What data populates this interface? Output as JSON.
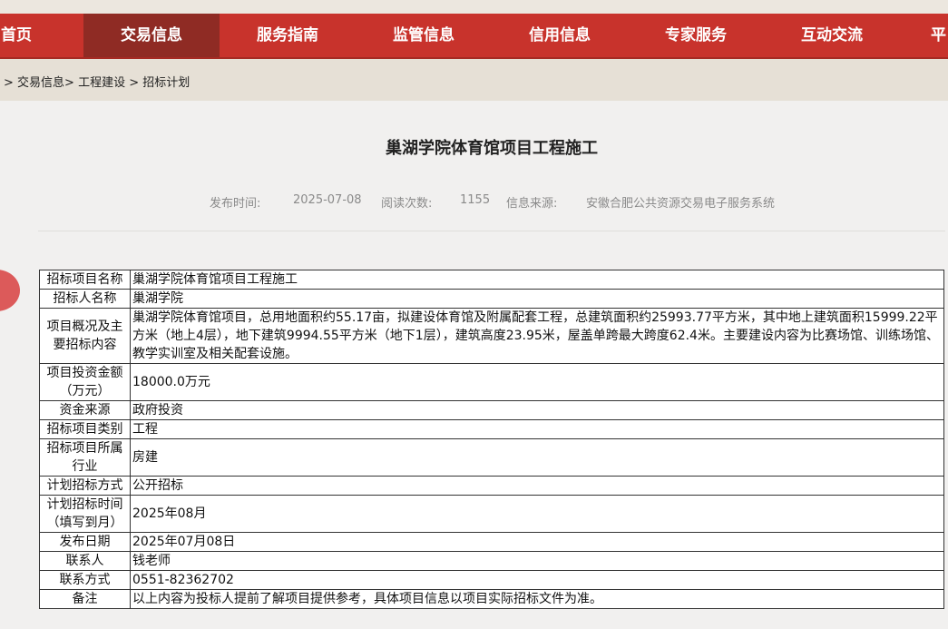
{
  "nav": {
    "items": [
      {
        "label": "首页"
      },
      {
        "label": "交易信息"
      },
      {
        "label": "服务指南"
      },
      {
        "label": "监管信息"
      },
      {
        "label": "信用信息"
      },
      {
        "label": "专家服务"
      },
      {
        "label": "互动交流"
      },
      {
        "label": "平"
      }
    ],
    "active": "交易信息"
  },
  "breadcrumb": {
    "items": [
      {
        "label": "> 交易信息>"
      },
      {
        "label": "工程建设"
      },
      {
        "label": "> 招标计划"
      }
    ]
  },
  "article": {
    "title": "巢湖学院体育馆项目工程施工",
    "meta": {
      "publish_label": "发布时间:",
      "publish_value": "2025-07-08",
      "reads_label": "阅读次数:",
      "reads_value": "1155",
      "source_label": "信息来源:",
      "source_value": "安徽合肥公共资源交易电子服务系统"
    }
  },
  "table": {
    "rows": [
      {
        "label": "招标项目名称",
        "value": "巢湖学院体育馆项目工程施工"
      },
      {
        "label": "招标人名称",
        "value": "巢湖学院"
      },
      {
        "label": "项目概况及主要招标内容",
        "value": "巢湖学院体育馆项目，总用地面积约55.17亩，拟建设体育馆及附属配套工程，总建筑面积约25993.77平方米，其中地上建筑面积15999.22平方米（地上4层），地下建筑9994.55平方米（地下1层），建筑高度23.95米，屋盖单跨最大跨度62.4米。主要建设内容为比赛场馆、训练场馆、教学实训室及相关配套设施。"
      },
      {
        "label": "项目投资金额（万元）",
        "value": "18000.0万元"
      },
      {
        "label": "资金来源",
        "value": "政府投资"
      },
      {
        "label": "招标项目类别",
        "value": "工程"
      },
      {
        "label": "招标项目所属行业",
        "value": "房建"
      },
      {
        "label": "计划招标方式",
        "value": "公开招标"
      },
      {
        "label": "计划招标时间（填写到月）",
        "value": "2025年08月"
      },
      {
        "label": "发布日期",
        "value": "2025年07月08日"
      },
      {
        "label": "联系人",
        "value": "钱老师"
      },
      {
        "label": "联系方式",
        "value": "0551-82362702"
      },
      {
        "label": "备注",
        "value": "以上内容为投标人提前了解项目提供参考，具体项目信息以项目实际招标文件为准。"
      }
    ]
  }
}
